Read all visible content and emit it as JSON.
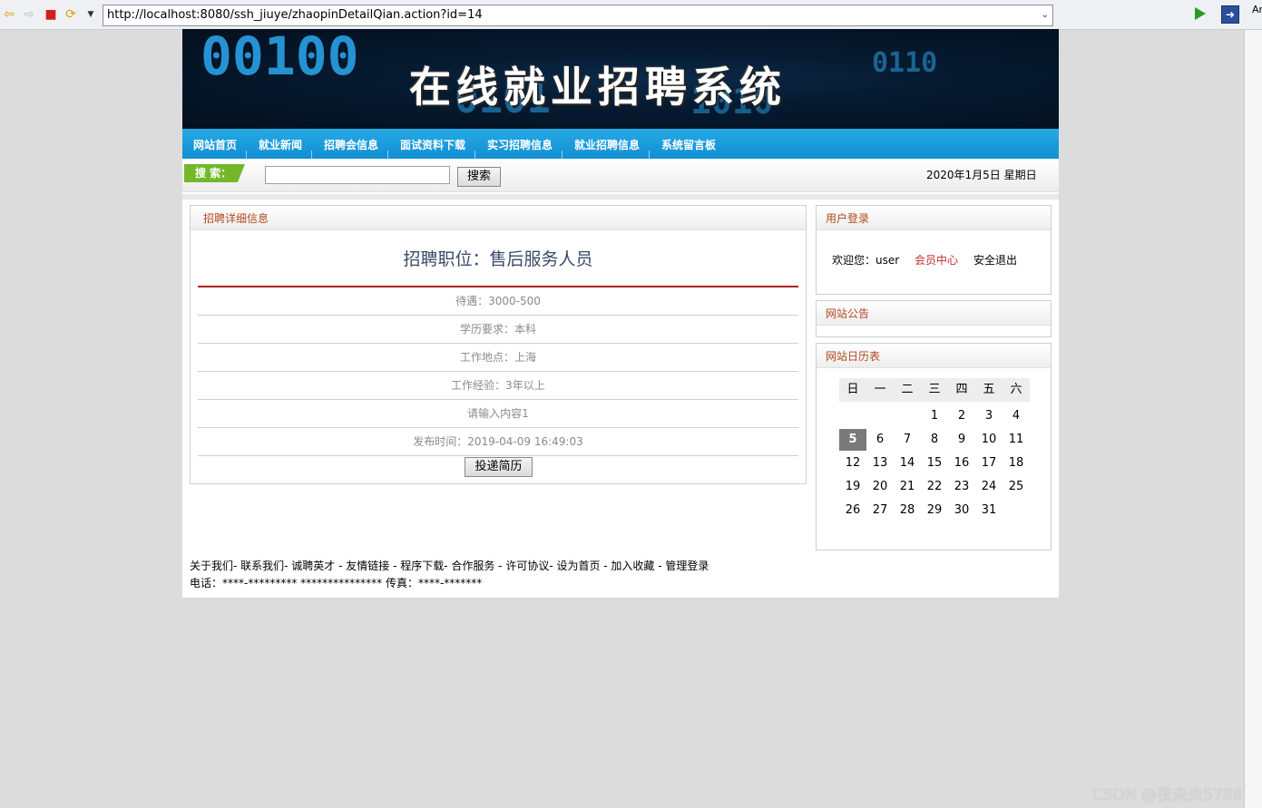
{
  "browser": {
    "url": "http://localhost:8080/ssh_jiuye/zhaopinDetailQian.action?id=14",
    "edge_label": "Ar"
  },
  "site": {
    "title": "在线就业招聘系统",
    "banner_digits": [
      "00100",
      "0101",
      "1010",
      "0110"
    ],
    "nav": [
      "网站首页",
      "就业新闻",
      "招聘会信息",
      "面试资料下载",
      "实习招聘信息",
      "就业招聘信息",
      "系统留言板"
    ],
    "search_label": "搜 索：",
    "search_button": "搜索",
    "date": "2020年1月5日 星期日"
  },
  "detail": {
    "panel_title": "招聘详细信息",
    "job_title": "招聘职位：售后服务人员",
    "rows": [
      "待遇：3000-500",
      "学历要求：本科",
      "工作地点：上海",
      "工作经验：3年以上",
      "请输入内容1",
      "发布时间：2019-04-09 16:49:03"
    ],
    "apply_button": "投递简历"
  },
  "login": {
    "panel_title": "用户登录",
    "welcome": "欢迎您：user",
    "member_center": "会员中心",
    "logout": "安全退出"
  },
  "notice": {
    "panel_title": "网站公告"
  },
  "calendar": {
    "panel_title": "网站日历表",
    "weekdays": [
      "日",
      "一",
      "二",
      "三",
      "四",
      "五",
      "六"
    ],
    "weeks": [
      [
        "",
        "",
        "",
        "1",
        "2",
        "3",
        "4"
      ],
      [
        "5",
        "6",
        "7",
        "8",
        "9",
        "10",
        "11"
      ],
      [
        "12",
        "13",
        "14",
        "15",
        "16",
        "17",
        "18"
      ],
      [
        "19",
        "20",
        "21",
        "22",
        "23",
        "24",
        "25"
      ],
      [
        "26",
        "27",
        "28",
        "29",
        "30",
        "31",
        ""
      ]
    ],
    "today": "5"
  },
  "footer": {
    "links": "关于我们- 联系我们- 诚聘英才 - 友情链接 - 程序下载- 合作服务 - 许可协议- 设为首页 - 加入收藏 - 管理登录",
    "contact": "电话：****-********* *************** 传真：****-*******"
  },
  "watermark": "CSDN @夜未央5788",
  "colors": {
    "nav": "#1a9fe0",
    "accent_red": "#b02020",
    "search_green": "#74b82a"
  }
}
